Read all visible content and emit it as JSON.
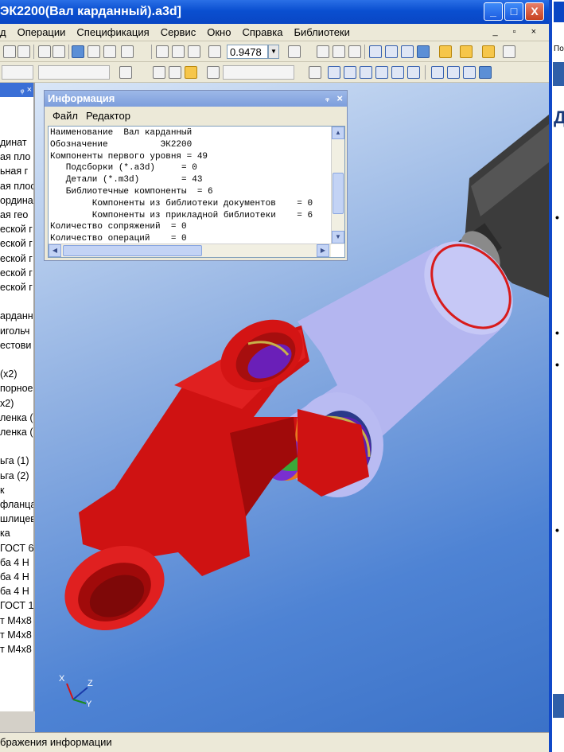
{
  "window": {
    "title": "ЭК2200(Вал карданный).a3d]",
    "minimize": "_",
    "maximize": "□",
    "close": "X"
  },
  "menu": {
    "items": [
      {
        "label": "д"
      },
      {
        "label": "Операции"
      },
      {
        "label": "Спецификация"
      },
      {
        "label": "Сервис"
      },
      {
        "label": "Окно"
      },
      {
        "label": "Справка"
      },
      {
        "label": "Библиотеки"
      }
    ],
    "mdi_controls": "_ ▫ ×"
  },
  "toolbar": {
    "zoom_value": "0.9478"
  },
  "left_panel": {
    "header_pin": "ᵩ ×",
    "items": [
      "динат",
      "ая пло",
      "ьная г",
      "ая плос",
      "ордина",
      "ая гео",
      "еской г",
      "еской г",
      "еской г",
      "еской г",
      "еской г",
      "",
      "арданн",
      "игольч",
      "естови",
      "",
      "(x2)",
      "порное",
      "x2)",
      "ленка (",
      "ленка (",
      "",
      "ьга (1)",
      "ьга (2)",
      "к",
      "фланца",
      "шлицев",
      "ка",
      "ГОСТ 6",
      "ба 4 Н",
      "ба 4 Н",
      "ба 4 Н",
      "ГОСТ 1",
      "т М4х8",
      "т М4х8",
      "т М4х8"
    ]
  },
  "info_dialog": {
    "title": "Информация",
    "menu_file": "Файл",
    "menu_editor": "Редактор",
    "lines": [
      "Наименование  Вал карданный",
      "Обозначение          ЭК2200",
      "Компоненты первого уровня = 49",
      "   Подсборки (*.a3d)     = 0",
      "   Детали (*.m3d)        = 43",
      "   Библиотечные компоненты  = 6",
      "        Компоненты из библиотеки документов    = 0",
      "        Компоненты из прикладной библиотеки    = 6",
      "Количество сопряжений  = 0",
      "Количество операций    = 0"
    ]
  },
  "axes": {
    "x": "X",
    "y": "Y",
    "z": "Z"
  },
  "status_bar": {
    "text": "бражения информации"
  },
  "right_window": {
    "label": "По",
    "heading": "Д",
    "bullet": "•"
  },
  "colors": {
    "titlebar": "#0a4fd0",
    "viewport_bg": "#4e83d4",
    "yoke_red": "#d41414",
    "yoke_lilac": "#b4b6f0",
    "shaft_dark": "#3c3c3c",
    "spider_purple": "#6a1fb8"
  }
}
